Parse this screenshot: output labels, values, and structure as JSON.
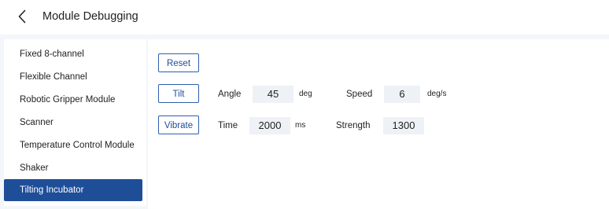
{
  "header": {
    "title": "Module Debugging"
  },
  "sidebar": {
    "items": [
      {
        "label": "Fixed 8-channel"
      },
      {
        "label": "Flexible Channel"
      },
      {
        "label": "Robotic Gripper Module"
      },
      {
        "label": "Scanner"
      },
      {
        "label": "Temperature Control Module"
      },
      {
        "label": "Shaker"
      },
      {
        "label": "Tilting Incubator"
      }
    ],
    "active": "Tilting Incubator"
  },
  "controls": {
    "reset": {
      "label": "Reset"
    },
    "tilt": {
      "label": "Tilt",
      "angle_label": "Angle",
      "angle_value": "45",
      "angle_unit": "deg",
      "speed_label": "Speed",
      "speed_value": "6",
      "speed_unit": "deg/s"
    },
    "vibrate": {
      "label": "Vibrate",
      "time_label": "Time",
      "time_value": "2000",
      "time_unit": "ms",
      "strength_label": "Strength",
      "strength_value": "1300"
    }
  },
  "colors": {
    "accent": "#1f4e99",
    "background": "#f3f6fa",
    "field": "#eef1f5"
  },
  "icons": {
    "back": "chevron-left-icon"
  }
}
